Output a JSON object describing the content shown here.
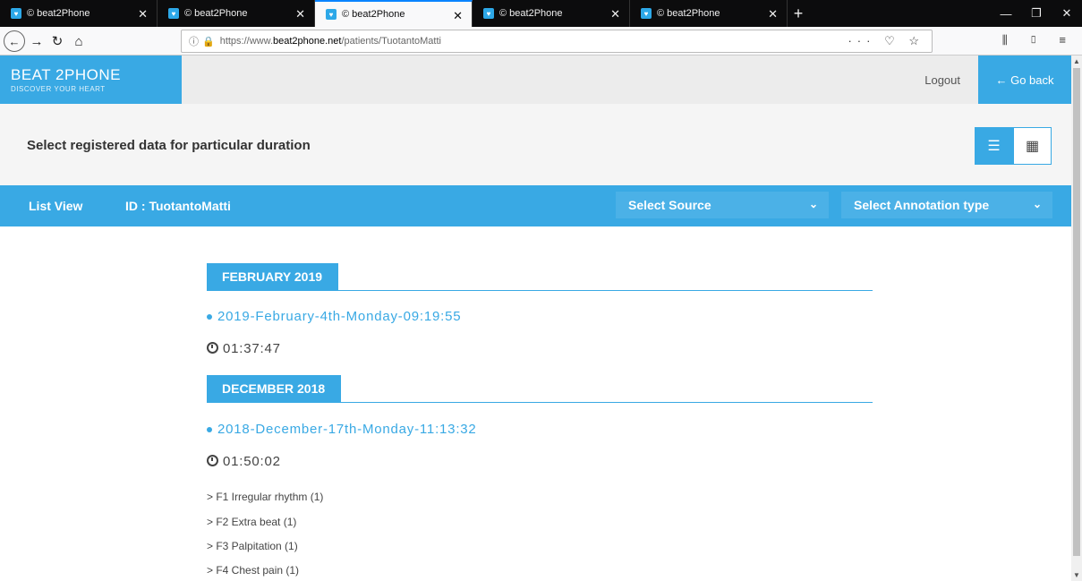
{
  "browser": {
    "tabs": [
      {
        "title": "© beat2Phone",
        "active": false
      },
      {
        "title": "© beat2Phone",
        "active": false
      },
      {
        "title": "© beat2Phone",
        "active": true
      },
      {
        "title": "© beat2Phone",
        "active": false
      },
      {
        "title": "© beat2Phone",
        "active": false
      }
    ],
    "url_prefix": "https://www.",
    "url_host": "beat2phone.net",
    "url_path": "/patients/TuotantoMatti"
  },
  "header": {
    "logo_title": "BEAT 2PHONE",
    "logo_subtitle": "DISCOVER YOUR HEART",
    "logout_label": "Logout",
    "goback_label": "← Go back"
  },
  "page": {
    "title": "Select registered data for particular duration"
  },
  "filters": {
    "view_label": "List View",
    "patient_id": "ID : TuotantoMatti",
    "source_label": "Select Source",
    "annotation_label": "Select Annotation type"
  },
  "records": {
    "groups": [
      {
        "month": "FEBRUARY 2019",
        "entries": [
          {
            "link": "2019-February-4th-Monday-09:19:55",
            "duration": "01:37:47",
            "annotations": []
          }
        ]
      },
      {
        "month": "DECEMBER 2018",
        "entries": [
          {
            "link": "2018-December-17th-Monday-11:13:32",
            "duration": "01:50:02",
            "annotations": [
              "> F1 Irregular rhythm (1)",
              "> F2 Extra beat (1)",
              "> F3 Palpitation (1)",
              "> F4 Chest pain (1)"
            ]
          }
        ]
      }
    ]
  },
  "colors": {
    "accent": "#39a9e4"
  }
}
